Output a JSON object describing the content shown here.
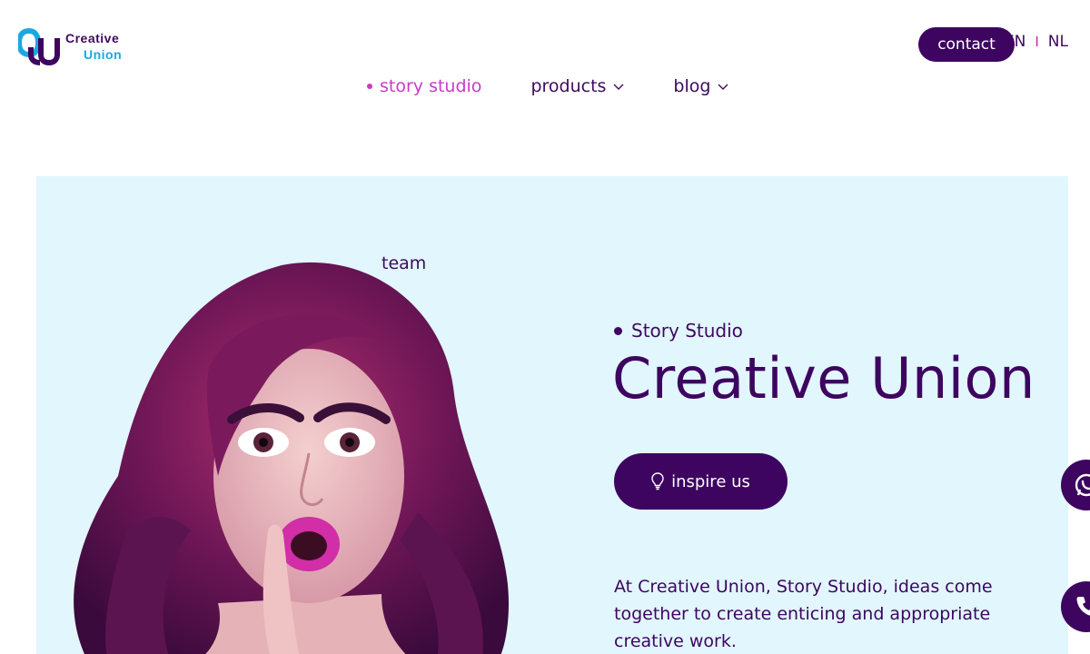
{
  "header": {
    "logo": {
      "line1": "Creative",
      "line2": "Union",
      "icon": "creative-union-logo"
    },
    "contact_label": "contact",
    "languages": [
      "EN",
      "NL"
    ],
    "language_separator": "I"
  },
  "nav": {
    "items": [
      {
        "label": "story studio",
        "active": true
      },
      {
        "label": "products",
        "has_dropdown": true
      },
      {
        "label": "blog",
        "has_dropdown": true
      }
    ]
  },
  "hero": {
    "team_label": "team",
    "eyebrow": "Story Studio",
    "headline": "Creative Union",
    "cta_label": "inspire us",
    "cta_icon": "lightbulb-icon",
    "body": "At Creative Union, Story Studio, ideas come together to create enticing and appropriate creative work.",
    "background_color": "#e2f6fd"
  },
  "floating": {
    "whatsapp_icon": "whatsapp-icon",
    "phone_icon": "phone-icon"
  },
  "colors": {
    "primary": "#3d0560",
    "accent": "#c83bc5",
    "brand_blue": "#19a9e1"
  }
}
